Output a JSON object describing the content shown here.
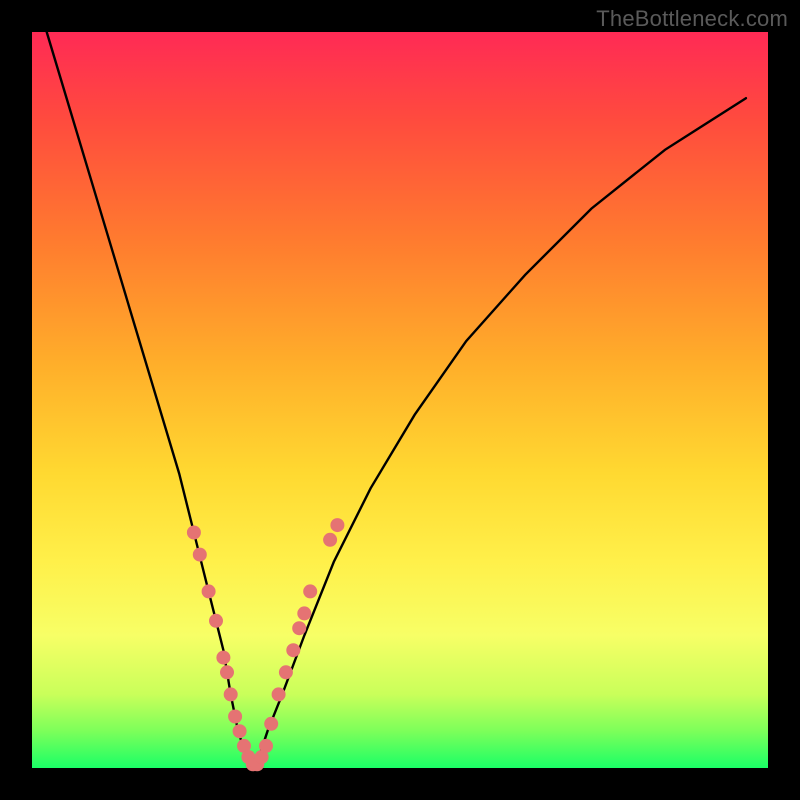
{
  "watermark": "TheBottleneck.com",
  "chart_data": {
    "type": "line",
    "title": "",
    "xlabel": "",
    "ylabel": "",
    "xlim": [
      0,
      100
    ],
    "ylim": [
      0,
      100
    ],
    "series": [
      {
        "name": "bottleneck-curve",
        "x": [
          2,
          5,
          8,
          11,
          14,
          17,
          20,
          22,
          24,
          26,
          27,
          28,
          29,
          30,
          31,
          32,
          34,
          37,
          41,
          46,
          52,
          59,
          67,
          76,
          86,
          97
        ],
        "values": [
          100,
          90,
          80,
          70,
          60,
          50,
          40,
          32,
          24,
          16,
          10,
          5,
          2,
          0,
          2,
          5,
          10,
          18,
          28,
          38,
          48,
          58,
          67,
          76,
          84,
          91
        ]
      }
    ],
    "markers": {
      "name": "highlight-dots",
      "color": "#e57373",
      "points": [
        {
          "x": 22.0,
          "y": 32
        },
        {
          "x": 22.8,
          "y": 29
        },
        {
          "x": 24.0,
          "y": 24
        },
        {
          "x": 25.0,
          "y": 20
        },
        {
          "x": 26.0,
          "y": 15
        },
        {
          "x": 26.5,
          "y": 13
        },
        {
          "x": 27.0,
          "y": 10
        },
        {
          "x": 27.6,
          "y": 7
        },
        {
          "x": 28.2,
          "y": 5
        },
        {
          "x": 28.8,
          "y": 3
        },
        {
          "x": 29.4,
          "y": 1.5
        },
        {
          "x": 30.0,
          "y": 0.5
        },
        {
          "x": 30.6,
          "y": 0.5
        },
        {
          "x": 31.2,
          "y": 1.5
        },
        {
          "x": 31.8,
          "y": 3
        },
        {
          "x": 32.5,
          "y": 6
        },
        {
          "x": 33.5,
          "y": 10
        },
        {
          "x": 34.5,
          "y": 13
        },
        {
          "x": 35.5,
          "y": 16
        },
        {
          "x": 36.3,
          "y": 19
        },
        {
          "x": 37.0,
          "y": 21
        },
        {
          "x": 37.8,
          "y": 24
        },
        {
          "x": 40.5,
          "y": 31
        },
        {
          "x": 41.5,
          "y": 33
        }
      ]
    },
    "background_gradient": {
      "top": "#ff2a55",
      "bottom": "#1aff66"
    }
  }
}
